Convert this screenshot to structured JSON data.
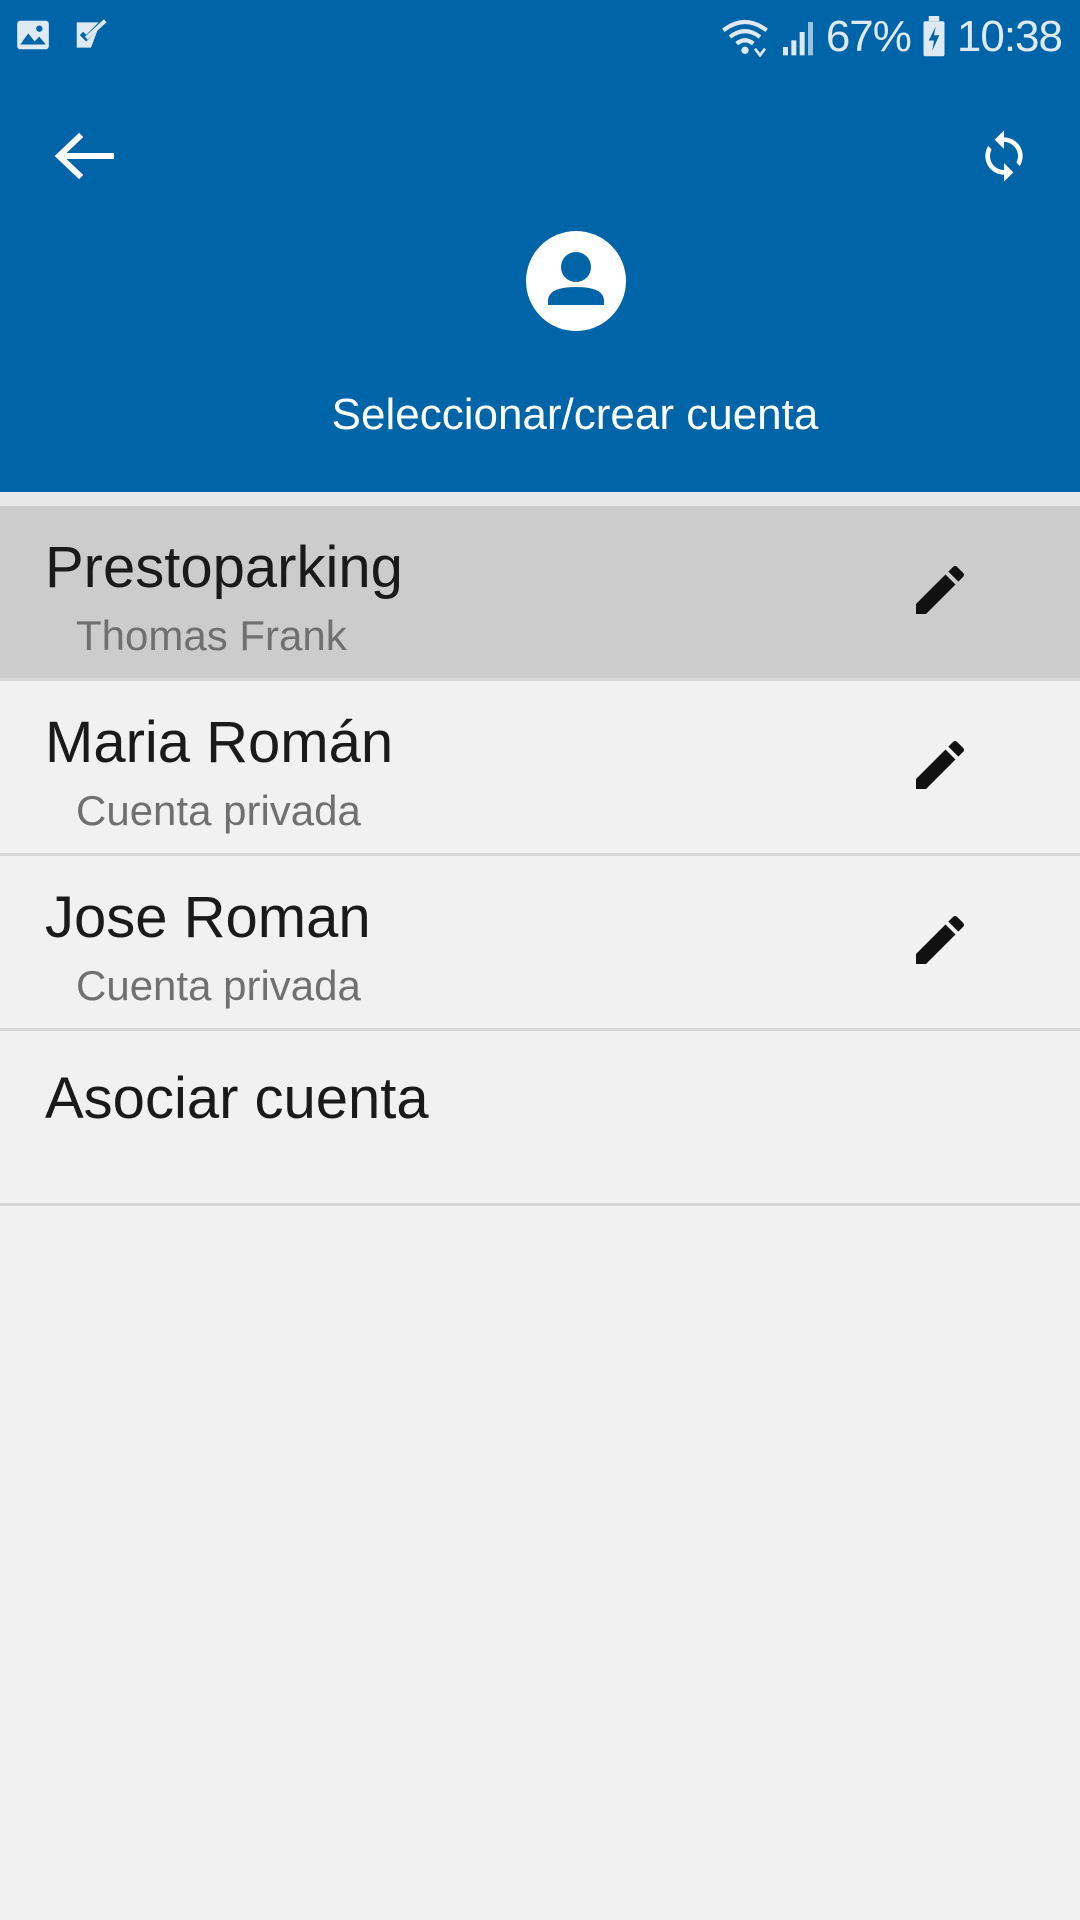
{
  "status_bar": {
    "left_icons": [
      "gallery-icon",
      "checklist-icon"
    ],
    "battery_percent": "67%",
    "time": "10:38"
  },
  "header": {
    "title": "Seleccionar/crear cuenta",
    "background_color": "#0064a8",
    "icons": {
      "back": "arrow-back-icon",
      "sync": "sync-icon",
      "avatar": "account-circle-icon"
    }
  },
  "accounts": [
    {
      "name": "Prestoparking",
      "subtitle": "Thomas Frank",
      "selected": true
    },
    {
      "name": "Maria Román",
      "subtitle": "Cuenta privada",
      "selected": false
    },
    {
      "name": "Jose Roman",
      "subtitle": "Cuenta privada",
      "selected": false
    }
  ],
  "associate_account": {
    "label": "Asociar cuenta"
  }
}
